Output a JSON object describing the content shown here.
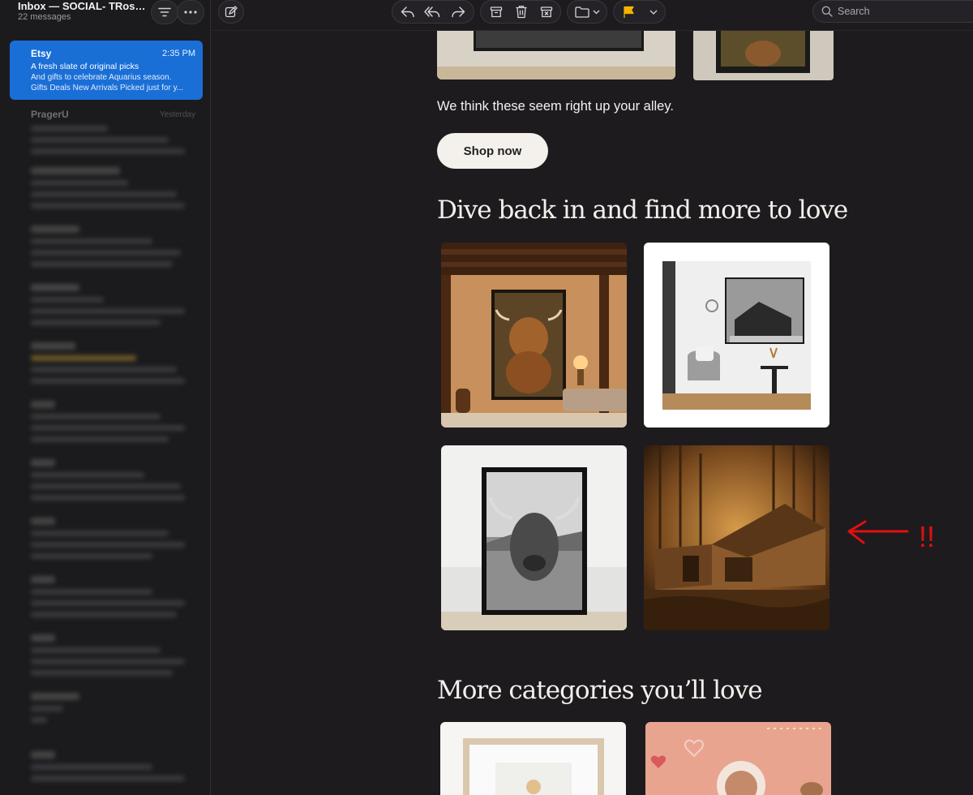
{
  "mailbox": {
    "title": "Inbox — SOCIAL- TRose...",
    "count": "22 messages"
  },
  "selected_message": {
    "sender": "Etsy",
    "time": "2:35 PM",
    "subject": "A fresh slate of original picks",
    "preview_line1": "And gifts to celebrate Aquarius season.",
    "preview_line2": "Gifts Deals New Arrivals Picked just for y..."
  },
  "message_list": [
    {
      "sender": "PragerU",
      "time": "Yesterday"
    },
    {
      "sender": "",
      "time": ""
    },
    {
      "sender": "",
      "time": ""
    },
    {
      "sender": "",
      "time": ""
    },
    {
      "sender": "",
      "time": ""
    },
    {
      "sender": "",
      "time": ""
    },
    {
      "sender": "",
      "time": ""
    },
    {
      "sender": "",
      "time": ""
    },
    {
      "sender": "",
      "time": ""
    },
    {
      "sender": "",
      "time": ""
    },
    {
      "sender": "",
      "time": ""
    },
    {
      "sender": "",
      "time": ""
    }
  ],
  "toolbar": {
    "search_placeholder": "Search",
    "flag_color": "#f5b400",
    "icons": [
      "filter-icon",
      "more-icon",
      "compose-icon",
      "reply-icon",
      "reply-all-icon",
      "forward-icon",
      "archive-icon",
      "trash-icon",
      "junk-icon",
      "move-folder-icon",
      "flag-icon",
      "chevron-down-icon",
      "search-icon"
    ]
  },
  "email": {
    "intro_text": "We think these seem right up your alley.",
    "shop_button": "Shop now",
    "section_dive": "Dive back in and find more to love",
    "section_more": "More categories you’ll love",
    "products": [
      {
        "image": "highland cow painting in rustic room"
      },
      {
        "image": "black and white barn print on wall"
      },
      {
        "image": "black and white highland cow poster"
      },
      {
        "image": "rustic barn in autumn forest"
      }
    ],
    "categories": [
      {
        "image": "framed dog print"
      },
      {
        "image": "valentine photo collage"
      }
    ]
  },
  "annotation": {
    "mark": "!!",
    "color": "#e01010"
  }
}
